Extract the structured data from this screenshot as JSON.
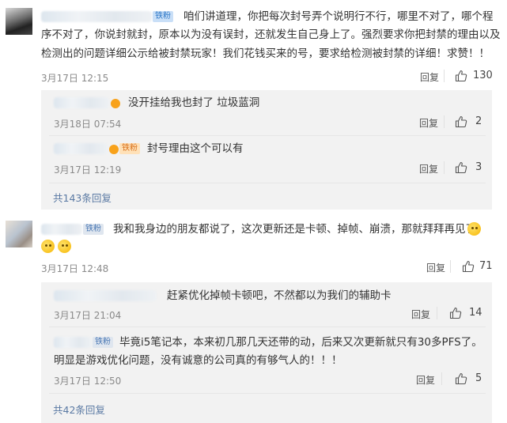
{
  "comments": [
    {
      "badge": "铁粉",
      "text_line1": "咱们讲道理，你把每次封号弄个说明行不行，哪里不对了，哪个程",
      "text_line2": "序不对了，你说封就封，原本以为没有误封，还就发生自己身上了。强烈要求你把封禁的理由以及",
      "text_line3": "检测出的问题详细公示给被封禁玩家！我们花钱买来的号，要求给检测被封禁的详细！求赞！！",
      "time": "3月17日 12:15",
      "reply_label": "回复",
      "likes": "130"
    },
    {
      "badge": "铁粉",
      "text_line1": "我和我身边的朋友都说了，这次更新还是卡顿、掉帧、崩溃，那就拜拜再见了",
      "time": "3月17日 12:48",
      "reply_label": "回复",
      "likes": "71"
    }
  ],
  "replies_group1": [
    {
      "text": "没开挂给我也封了 垃圾蓝洞",
      "time": "3月18日 07:54",
      "reply_label": "回复",
      "likes": "2"
    },
    {
      "badge": "铁粉",
      "text": "封号理由这个可以有",
      "time": "3月17日 12:19",
      "reply_label": "回复",
      "likes": "3"
    }
  ],
  "more_group1": "共143条回复",
  "replies_group2": [
    {
      "text": "赶紧优化掉帧卡顿吧，不然都以为我们的辅助卡",
      "time": "3月17日 21:04",
      "reply_label": "回复",
      "likes": "14"
    },
    {
      "badge": "铁粉",
      "text_line1": "毕竟i5笔记本，本来初几那几天还带的动，后来又次更新就只有30多PFS了。",
      "text_line2": "明显是游戏优化问题，没有诚意的公司真的有够气人的！！！",
      "time": "3月17日 12:50",
      "reply_label": "回复",
      "likes": "5"
    }
  ],
  "more_group2": "共42条回复",
  "colors": {
    "link": "#5a79a3",
    "badge_blue": "#2f79c8",
    "badge_orange": "#d8701a"
  },
  "icons": {
    "like": "thumbs-up-icon",
    "emoji": "grinning-face-icon",
    "verified": "v-badge-icon"
  }
}
